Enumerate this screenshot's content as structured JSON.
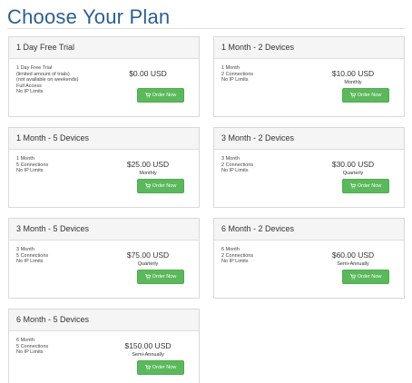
{
  "page": {
    "title": "Choose Your Plan",
    "accent_color": "#2b5f93",
    "button_color": "#5cb85c"
  },
  "plans": [
    {
      "name": "1 Day Free Trial",
      "features": [
        "1 Day Free Trial",
        "(limited amount of trials)",
        "(not available on weekends)",
        "Full Access",
        "No IP Limits"
      ],
      "price": "$0.00 USD",
      "cycle": "",
      "button": "Order Now"
    },
    {
      "name": "1 Month - 2 Devices",
      "features": [
        "1 Month",
        "2 Connections",
        "No IP Limits"
      ],
      "price": "$10.00 USD",
      "cycle": "Monthly",
      "button": "Order Now"
    },
    {
      "name": "1 Month - 5 Devices",
      "features": [
        "1 Month",
        "5 Connections",
        "No IP Limits"
      ],
      "price": "$25.00 USD",
      "cycle": "Monthly",
      "button": "Order Now"
    },
    {
      "name": "3 Month - 2 Devices",
      "features": [
        "3 Month",
        "2 Connections",
        "No IP Limits"
      ],
      "price": "$30.00 USD",
      "cycle": "Quarterly",
      "button": "Order Now"
    },
    {
      "name": "3 Month - 5 Devices",
      "features": [
        "3 Month",
        "5 Connections",
        "No IP Limits"
      ],
      "price": "$75.00 USD",
      "cycle": "Quarterly",
      "button": "Order Now"
    },
    {
      "name": "6 Month - 2 Devices",
      "features": [
        "6 Month",
        "2 Connections",
        "No IP Limits"
      ],
      "price": "$60.00 USD",
      "cycle": "Semi-Annually",
      "button": "Order Now"
    },
    {
      "name": "6 Month - 5 Devices",
      "features": [
        "6 Month",
        "5 Connections",
        "No IP Limits"
      ],
      "price": "$150.00 USD",
      "cycle": "Semi-Annually",
      "button": "Order Now"
    }
  ],
  "icons": {
    "order_button": "shopping-cart-icon"
  }
}
